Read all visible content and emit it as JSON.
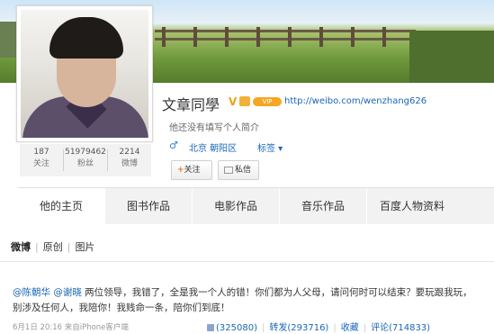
{
  "profile": {
    "name": "文章同學",
    "verified_badge": "V",
    "vip_badge": "VIP",
    "url": "http://weibo.com/wenzhang626",
    "bio": "他还没有填写个人简介",
    "gender_symbol": "♂",
    "location": "北京 朝阳区",
    "tags_label": "标签 ▾",
    "follow_button": "关注",
    "follow_plus": "+",
    "message_button": "私信"
  },
  "stats": [
    {
      "value": "187",
      "label": "关注"
    },
    {
      "value": "51979462",
      "label": "粉丝"
    },
    {
      "value": "2214",
      "label": "微博"
    }
  ],
  "tabs": [
    "他的主页",
    "图书作品",
    "电影作品",
    "音乐作品",
    "百度人物资料"
  ],
  "subnav": [
    "微博",
    "原创",
    "图片"
  ],
  "post": {
    "mention1": "@陈朝华",
    "mention2": "@谢晓",
    "text": " 两位领导，我错了，全是我一个人的错！你们都为人父母，请问何时可以结束？要玩跟我玩，别涉及任何人，我陪你！我贱命一条，陪你们到底！",
    "meta": "6月1日 20:16  来自iPhone客户端",
    "like": "(325080)",
    "repost": "转发(293716)",
    "favorite": "收藏",
    "comment": "评论(714833)"
  },
  "colors": {
    "link": "#1a66b5",
    "tab_bg": "#f2f2f2",
    "accent": "#e8791a"
  }
}
